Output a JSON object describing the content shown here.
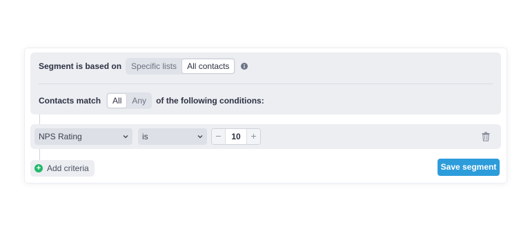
{
  "segment": {
    "based_on_label": "Segment is based on",
    "options": [
      "Specific lists",
      "All contacts"
    ],
    "selected": "All contacts"
  },
  "match": {
    "label": "Contacts match",
    "options": [
      "All",
      "Any"
    ],
    "selected": "All",
    "suffix": "of the following conditions:"
  },
  "condition": {
    "field": "NPS Rating",
    "operator": "is",
    "value": "10",
    "minus": "−",
    "plus": "+"
  },
  "actions": {
    "add_criteria": "Add criteria",
    "add_icon": "+",
    "save": "Save segment"
  },
  "colors": {
    "accent": "#2d9cdb",
    "add_green": "#20b86a",
    "panel_bg": "#eceef2"
  },
  "icons": [
    "info-icon",
    "chevron-down-icon",
    "trash-icon",
    "plus-circle-icon"
  ]
}
